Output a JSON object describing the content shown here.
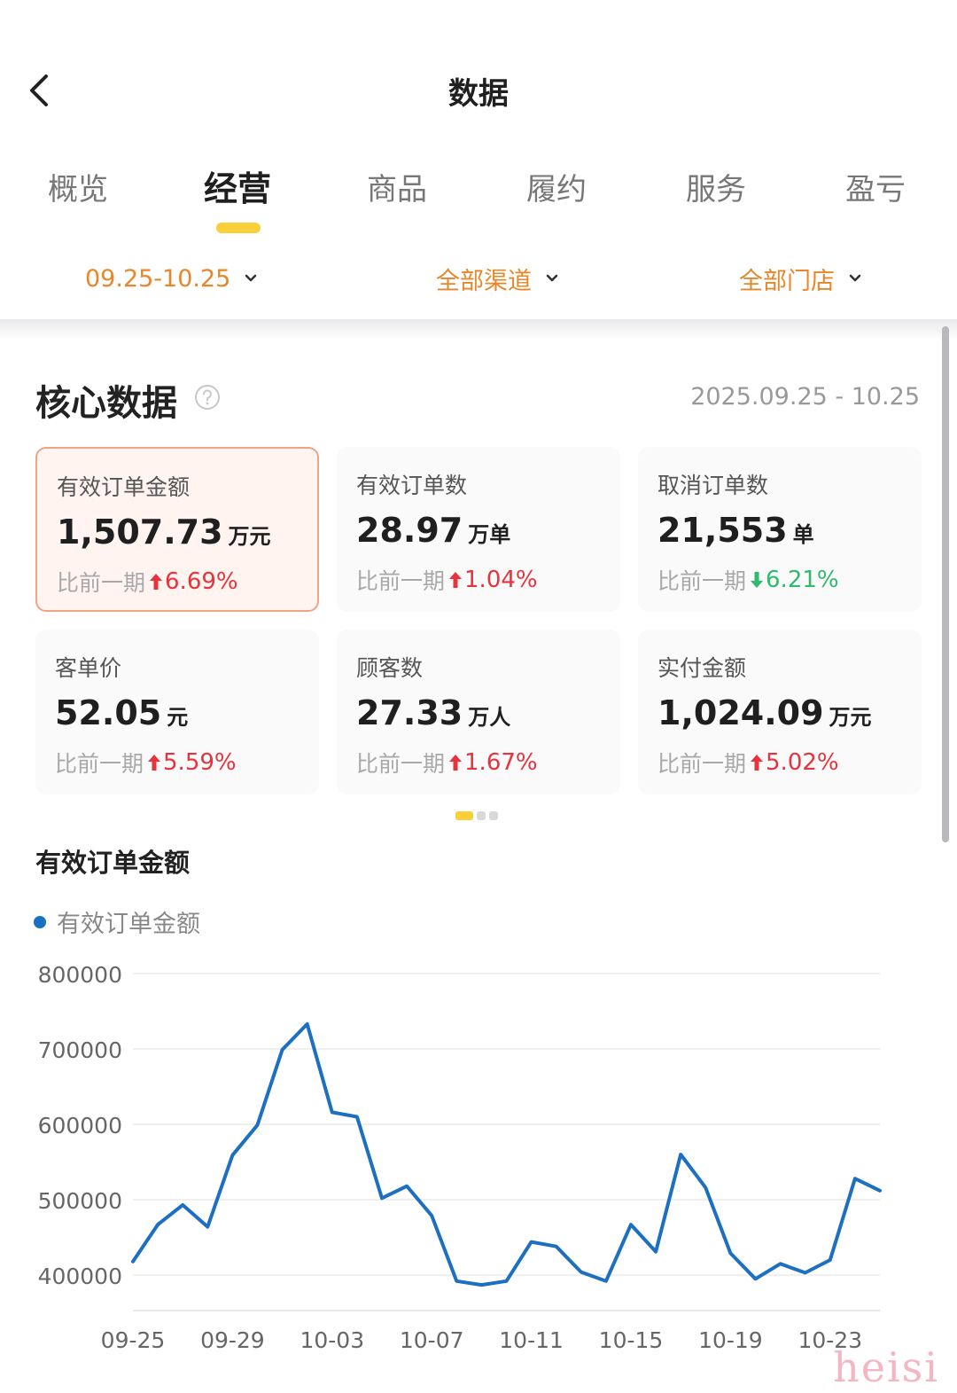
{
  "header": {
    "title": "数据",
    "tabs": [
      {
        "label": "概览",
        "active": false
      },
      {
        "label": "经营",
        "active": true
      },
      {
        "label": "商品",
        "active": false
      },
      {
        "label": "履约",
        "active": false
      },
      {
        "label": "服务",
        "active": false
      },
      {
        "label": "盈亏",
        "active": false
      }
    ],
    "filters": [
      {
        "label": "09.25-10.25"
      },
      {
        "label": "全部渠道"
      },
      {
        "label": "全部门店"
      }
    ]
  },
  "core": {
    "title": "核心数据",
    "date_range": "2025.09.25 - 10.25",
    "compare_label": "比前一期",
    "cards": [
      {
        "label": "有效订单金额",
        "value": "1,507.73",
        "unit": "万元",
        "change": "6.69%",
        "direction": "up",
        "selected": true
      },
      {
        "label": "有效订单数",
        "value": "28.97",
        "unit": "万单",
        "change": "1.04%",
        "direction": "up",
        "selected": false
      },
      {
        "label": "取消订单数",
        "value": "21,553",
        "unit": "单",
        "change": "6.21%",
        "direction": "down",
        "selected": false
      },
      {
        "label": "客单价",
        "value": "52.05",
        "unit": "元",
        "change": "5.59%",
        "direction": "up",
        "selected": false
      },
      {
        "label": "顾客数",
        "value": "27.33",
        "unit": "万人",
        "change": "1.67%",
        "direction": "up",
        "selected": false
      },
      {
        "label": "实付金额",
        "value": "1,024.09",
        "unit": "万元",
        "change": "5.02%",
        "direction": "up",
        "selected": false
      }
    ],
    "pager": {
      "pages": 3,
      "current": 0
    }
  },
  "chart_section": {
    "title": "有效订单金额"
  },
  "colors": {
    "accent": "#e8872a",
    "tab_indicator": "#f9cf3a",
    "up": "#e8323c",
    "down": "#2fba6e",
    "series": "#1c6fc1"
  },
  "watermark": "heisi",
  "chart_data": {
    "type": "line",
    "title": "",
    "xlabel": "",
    "ylabel": "",
    "ylim": [
      400000,
      800000
    ],
    "yticks": [
      400000,
      500000,
      600000,
      700000,
      800000
    ],
    "xtick_labels": [
      "09-25",
      "09-29",
      "10-03",
      "10-07",
      "10-11",
      "10-15",
      "10-19",
      "10-23"
    ],
    "grid": true,
    "legend": "top-left",
    "x": [
      "09-25",
      "09-26",
      "09-27",
      "09-28",
      "09-29",
      "09-30",
      "10-01",
      "10-02",
      "10-03",
      "10-04",
      "10-05",
      "10-06",
      "10-07",
      "10-08",
      "10-09",
      "10-10",
      "10-11",
      "10-12",
      "10-13",
      "10-14",
      "10-15",
      "10-16",
      "10-17",
      "10-18",
      "10-19",
      "10-20",
      "10-21",
      "10-22",
      "10-23",
      "10-24",
      "10-25"
    ],
    "series": [
      {
        "name": "有效订单金额",
        "values": [
          418000,
          467000,
          493000,
          464000,
          559000,
          599000,
          699000,
          733000,
          616000,
          610000,
          502000,
          518000,
          479000,
          392000,
          387000,
          392000,
          444000,
          438000,
          404000,
          392000,
          467000,
          431000,
          560000,
          516000,
          429000,
          395000,
          415000,
          403000,
          420000,
          528000,
          512000
        ]
      }
    ]
  }
}
